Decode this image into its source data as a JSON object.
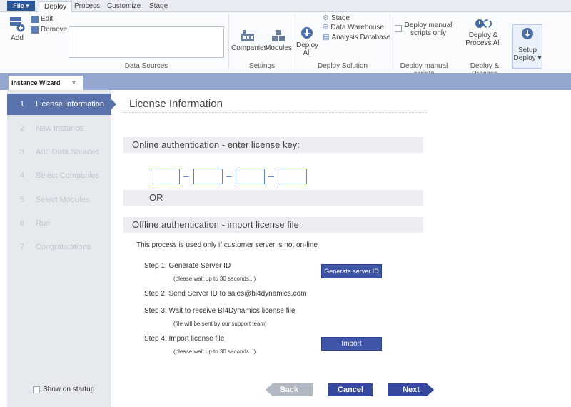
{
  "ribbon": {
    "file_label": "File ▾",
    "tabs": [
      "Deploy",
      "Process",
      "Customize",
      "Stage"
    ],
    "active_tab": "Deploy",
    "data_sources": {
      "add": "Add",
      "edit": "Edit",
      "remove": "Remove",
      "group": "Data Sources"
    },
    "settings": {
      "companies": "Companies",
      "modules": "Modules",
      "group": "Settings"
    },
    "deploy_solution": {
      "deploy_all_1": "Deploy",
      "deploy_all_2": "All",
      "stage": "Stage",
      "data_warehouse": "Data Warehouse",
      "analysis_database": "Analysis Database",
      "group": "Deploy Solution"
    },
    "manual": {
      "label_1": "Deploy manual",
      "label_2": "scripts only",
      "group": "Deploy manual scripts"
    },
    "deploy_process": {
      "label_1": "Deploy &",
      "label_2": "Process All",
      "group": "Deploy & Process"
    },
    "setup": {
      "label_1": "Setup",
      "label_2": "Deploy ▾"
    }
  },
  "doc_tab": {
    "label": "Instance Wizard",
    "close": "×"
  },
  "steps": [
    {
      "num": "1",
      "label": "License Information"
    },
    {
      "num": "2",
      "label": "New Instance"
    },
    {
      "num": "3",
      "label": "Add Data Sources"
    },
    {
      "num": "4",
      "label": "Select Companies"
    },
    {
      "num": "5",
      "label": "Select Modules"
    },
    {
      "num": "6",
      "label": "Run"
    },
    {
      "num": "7",
      "label": "Congratulations"
    }
  ],
  "show_on_startup": "Show on startup",
  "main": {
    "title": "License Information",
    "online_heading": "Online authentication - enter license key:",
    "or": "OR",
    "offline_heading": "Offline authentication - import license file:",
    "offline_note": "This process is used only if customer server is not on-line",
    "step1": "Step 1: Generate Server ID",
    "step1_note": "(please wait up to 30 seconds...)",
    "generate_button": "Generate server ID",
    "step2": "Step 2: Send Server ID to sales@bi4dynamics.com",
    "step3": "Step 3: Wait to receive BI4Dynamics license file",
    "step3_note": "(file will be sent by our support team)",
    "step4": "Step 4: Import license file",
    "step4_note": "(please wait up to 30 seconds...)",
    "import_button": "Import"
  },
  "nav": {
    "back": "Back",
    "cancel": "Cancel",
    "next": "Next"
  },
  "colors": {
    "accent": "#36489e",
    "nav_active": "#5b73ad",
    "tabstrip": "#95a7d1"
  }
}
